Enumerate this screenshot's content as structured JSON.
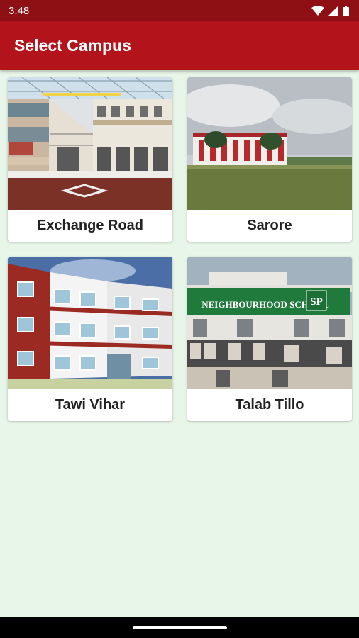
{
  "status_bar": {
    "time": "3:48"
  },
  "app_bar": {
    "title": "Select Campus"
  },
  "campuses": [
    {
      "name": "Exchange Road"
    },
    {
      "name": "Sarore"
    },
    {
      "name": "Tawi Vihar"
    },
    {
      "name": "Talab Tillo"
    }
  ],
  "talab_tillo_sign": {
    "main": "NEIGHBOURHOOD SCHOOL",
    "logo": "SP"
  },
  "colors": {
    "status_bar": "#8e0f14",
    "app_bar": "#b3131b",
    "background": "#e8f5e9"
  }
}
